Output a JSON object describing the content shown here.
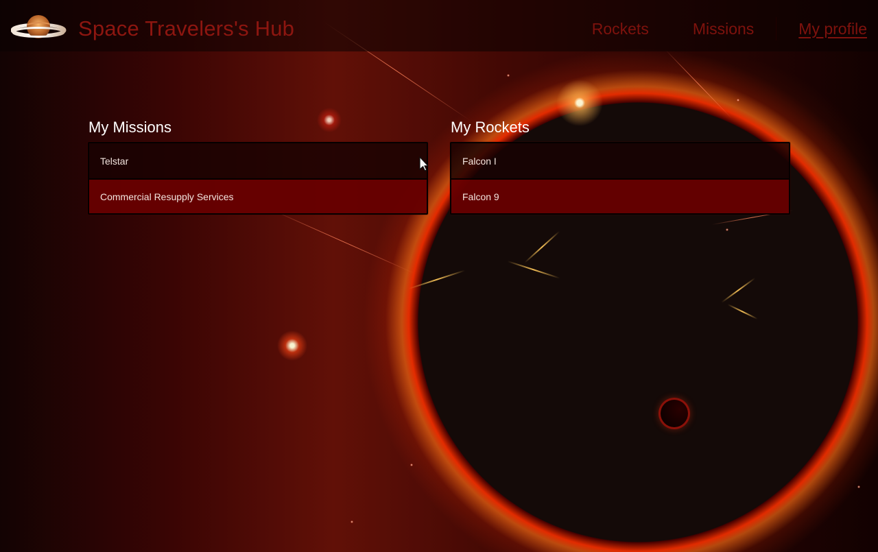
{
  "header": {
    "site_title": "Space Travelers's Hub",
    "logo_icon": "planet-icon"
  },
  "nav": {
    "rockets": "Rockets",
    "missions": "Missions",
    "profile": "My profile"
  },
  "profile": {
    "missions_title": "My Missions",
    "rockets_title": "My Rockets",
    "missions": [
      "Telstar",
      "Commercial Resupply Services"
    ],
    "rockets": [
      "Falcon I",
      "Falcon 9"
    ]
  },
  "colors": {
    "title_red": "#8d1610",
    "nav_red": "#7e120d",
    "row_red": "#680000",
    "row_dark": "#190303",
    "text_light": "#f3e5df"
  },
  "cursor_icon": "mouse-pointer-icon"
}
